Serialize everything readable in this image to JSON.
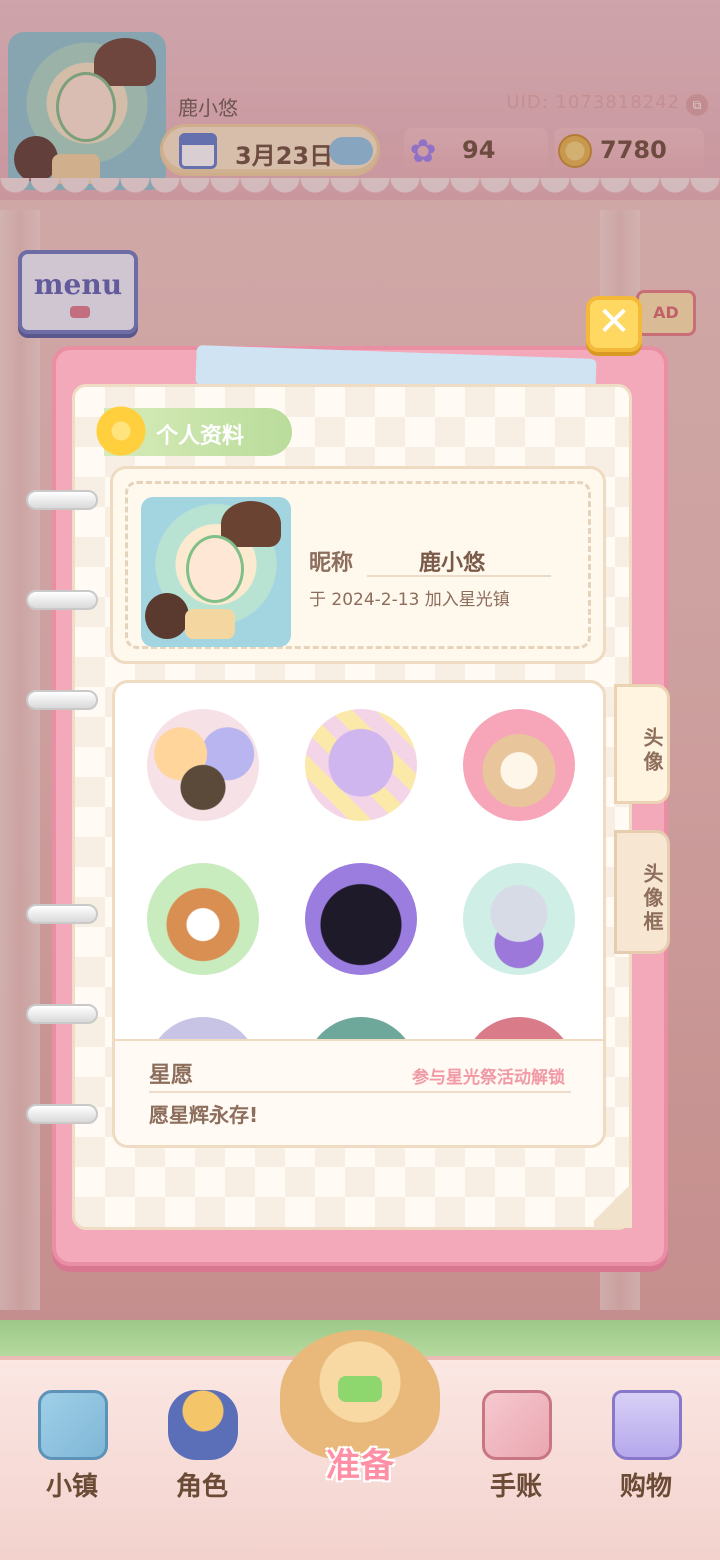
{
  "header": {
    "player_name": "鹿小悠",
    "uid": "UID: 1073818242",
    "date": "3月23日",
    "star_count": "94",
    "coin_count": "7780"
  },
  "menu": {
    "label": "menu"
  },
  "ad_badge": "AD",
  "profile": {
    "section_title": "个人资料",
    "nickname_label": "昵称",
    "nickname_value": "鹿小悠",
    "join_text": "于 2024-2-13 加入星光镇"
  },
  "side_tabs": [
    {
      "label": "头像",
      "active": true
    },
    {
      "label": "头像框",
      "active": false
    }
  ],
  "wish": {
    "title": "星愿",
    "unlock_link": "参与星光祭活动解锁",
    "text": "愿星辉永存!"
  },
  "bottom_nav": [
    {
      "label": "小镇",
      "icon": "map-icon"
    },
    {
      "label": "角色",
      "icon": "dress-icon"
    },
    {
      "label": "准备",
      "icon": "basket-icon"
    },
    {
      "label": "手账",
      "icon": "journal-icon"
    },
    {
      "label": "购物",
      "icon": "shopping-bag-icon"
    }
  ],
  "colors": {
    "notebook_pink": "#f3a9ba",
    "tab_green": "#b9dc9b",
    "text_brown": "#8d6d5c",
    "link_pink": "#f19aa6"
  }
}
